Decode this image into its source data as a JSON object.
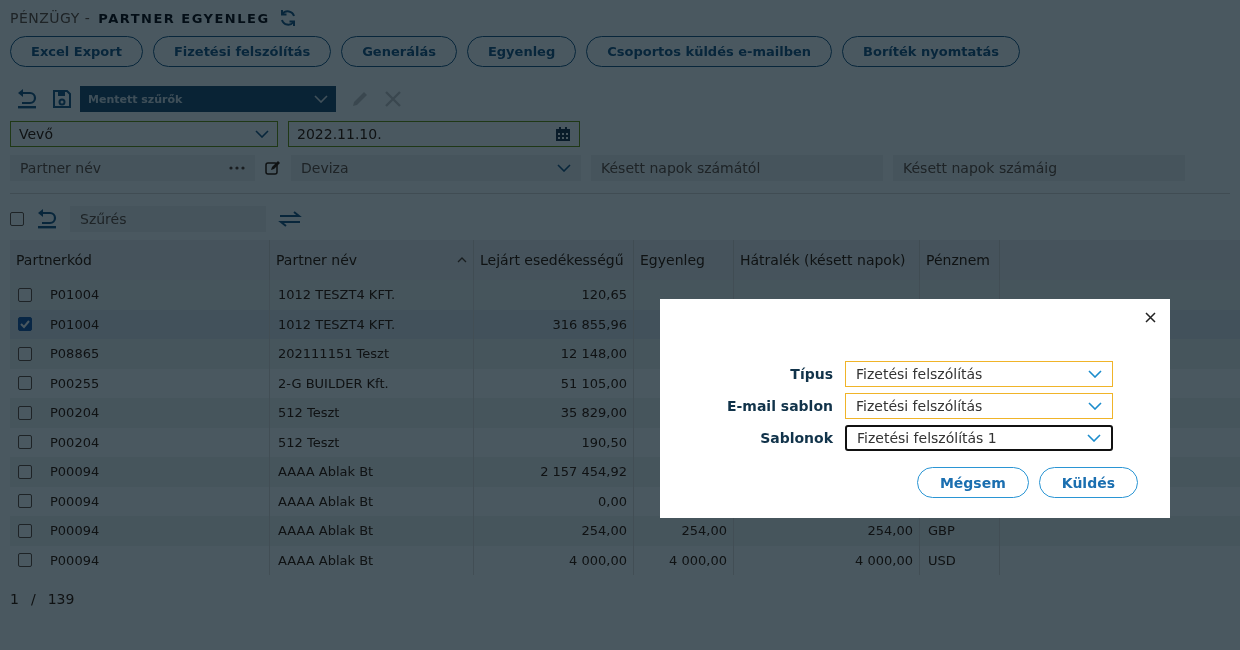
{
  "header": {
    "section": "PÉNZÜGY -",
    "title": "PARTNER EGYENLEG"
  },
  "actions": [
    "Excel Export",
    "Fizetési felszólítás",
    "Generálás",
    "Egyenleg",
    "Csoportos küldés e-mailben",
    "Boríték nyomtatás"
  ],
  "filter_toolbar": {
    "saved_filters": {
      "placeholder": "Mentett szűrők"
    }
  },
  "filters": {
    "partner_type": {
      "value": "Vevő"
    },
    "date": {
      "value": "2022.11.10."
    },
    "partner_name": {
      "placeholder": "Partner név"
    },
    "currency": {
      "placeholder": "Deviza"
    },
    "late_from": {
      "placeholder": "Késett napok számától"
    },
    "late_to": {
      "placeholder": "Késett napok számáig"
    }
  },
  "grid_toolbar": {
    "select_all": {
      "checked": false
    },
    "search": {
      "placeholder": "Szűrés"
    }
  },
  "table": {
    "columns": [
      {
        "label": "Partnerkód",
        "sorted": false
      },
      {
        "label": "Partner név",
        "sorted": true
      },
      {
        "label": "Lejárt esedékességű",
        "sorted": false
      },
      {
        "label": "Egyenleg",
        "sorted": false
      },
      {
        "label": "Hátralék (késett napok)",
        "sorted": false
      },
      {
        "label": "Pénznem",
        "sorted": false
      }
    ],
    "rows": [
      {
        "selected": false,
        "cells": [
          "P01004",
          "1012 TESZT4 KFT.",
          "120,65"
        ]
      },
      {
        "selected": true,
        "cells": [
          "P01004",
          "1012 TESZT4 KFT.",
          "316 855,96"
        ]
      },
      {
        "selected": false,
        "cells": [
          "P08865",
          "202111151 Teszt",
          "12 148,00"
        ]
      },
      {
        "selected": false,
        "cells": [
          "P00255",
          "2-G BUILDER Kft.",
          "51 105,00"
        ]
      },
      {
        "selected": false,
        "cells": [
          "P00204",
          "512 Teszt",
          "35 829,00"
        ]
      },
      {
        "selected": false,
        "cells": [
          "P00204",
          "512 Teszt",
          "190,50"
        ]
      },
      {
        "selected": false,
        "cells": [
          "P00094",
          "AAAA Ablak Bt",
          "2 157 454,92"
        ]
      },
      {
        "selected": false,
        "cells": [
          "P00094",
          "AAAA Ablak Bt",
          "0,00"
        ]
      },
      {
        "selected": false,
        "cells": [
          "P00094",
          "AAAA Ablak Bt",
          "254,00",
          "254,00",
          "254,00",
          "GBP"
        ]
      },
      {
        "selected": false,
        "cells": [
          "P00094",
          "AAAA Ablak Bt",
          "4 000,00",
          "4 000,00",
          "4 000,00",
          "USD"
        ]
      }
    ]
  },
  "pager": {
    "page": "1",
    "separator": "/",
    "total": "139"
  },
  "dialog": {
    "fields": [
      {
        "label": "Típus",
        "value": "Fizetési felszólítás",
        "focused": false
      },
      {
        "label": "E-mail sablon",
        "value": "Fizetési felszólítás",
        "focused": false
      },
      {
        "label": "Sablonok",
        "value": "Fizetési felszólítás 1",
        "focused": true
      }
    ],
    "buttons": [
      "Mégsem",
      "Küldés"
    ]
  }
}
